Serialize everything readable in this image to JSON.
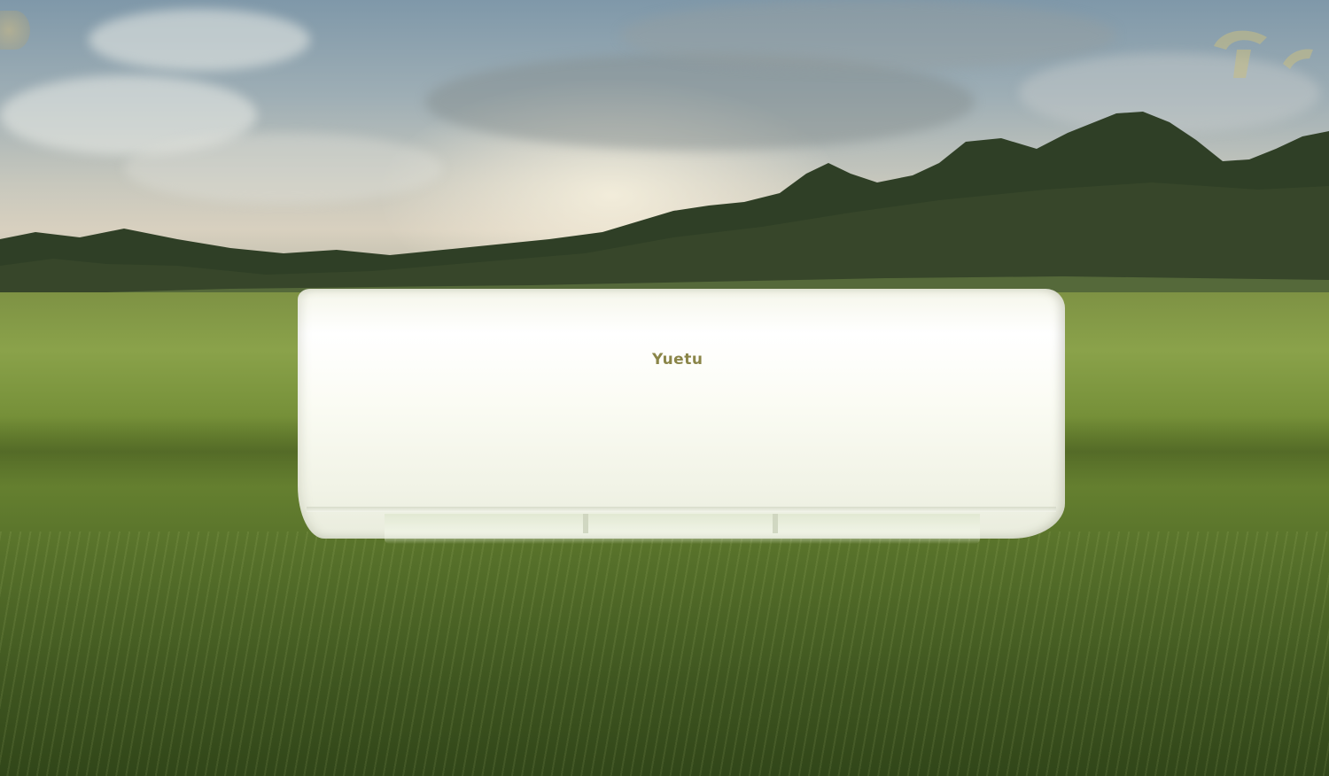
{
  "scene": {
    "description_type": "product-photo",
    "colors": {
      "sky": "#9eaeb5",
      "grass": "#6f8a33",
      "trees": "#2e3d25",
      "unit_body": "#fbfcf4",
      "brand_text": "#8a8548"
    }
  },
  "product": {
    "brand_label": "Yuetu"
  }
}
